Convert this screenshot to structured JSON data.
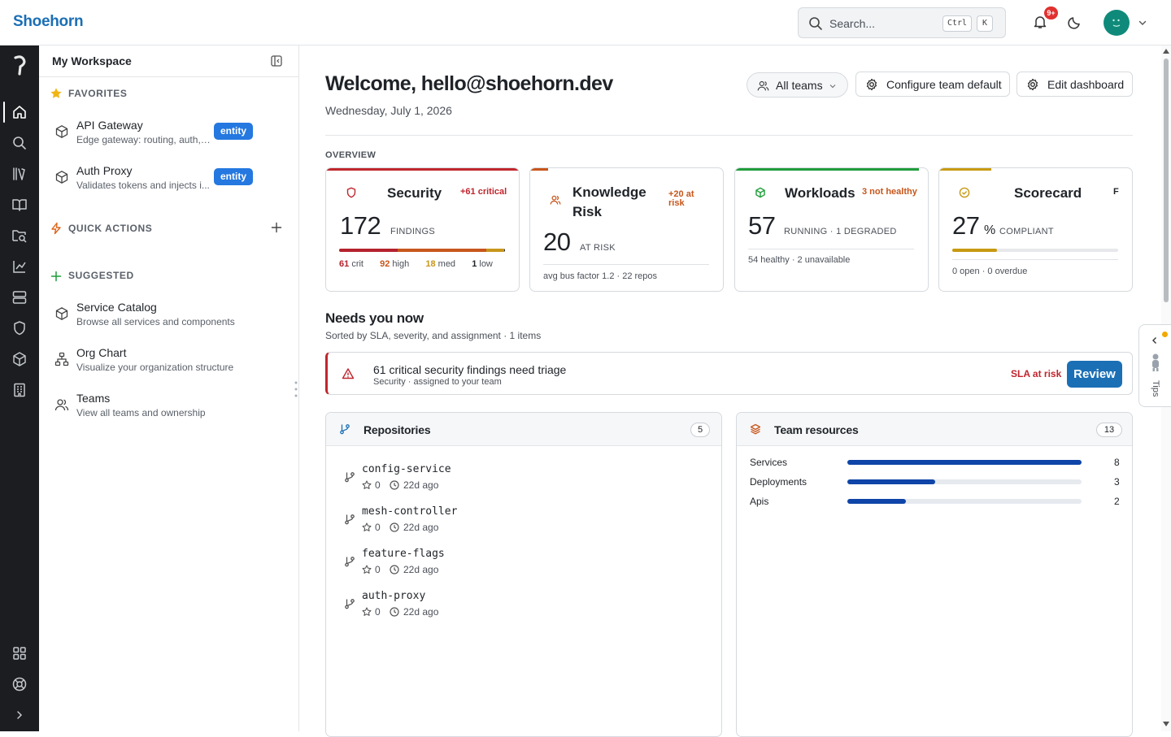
{
  "app": {
    "name": "Shoehorn"
  },
  "header": {
    "search_placeholder": "Search...",
    "shortcut_key1": "Ctrl",
    "shortcut_key2": "K",
    "notification_count": "9+"
  },
  "sidebar": {
    "title": "My Workspace",
    "favorites_label": "FAVORITES",
    "favorites": [
      {
        "title": "API Gateway",
        "subtitle": "Edge gateway: routing, auth, ...",
        "badge": "entity"
      },
      {
        "title": "Auth Proxy",
        "subtitle": "Validates tokens and injects i...",
        "badge": "entity"
      }
    ],
    "quick_actions_label": "QUICK ACTIONS",
    "suggested_label": "SUGGESTED",
    "suggested": [
      {
        "title": "Service Catalog",
        "subtitle": "Browse all services and components"
      },
      {
        "title": "Org Chart",
        "subtitle": "Visualize your organization structure"
      },
      {
        "title": "Teams",
        "subtitle": "View all teams and ownership"
      }
    ]
  },
  "main": {
    "welcome": "Welcome, hello@shoehorn.dev",
    "date": "Wednesday, July 1, 2026",
    "buttons": {
      "teams": "All teams",
      "configure": "Configure team default",
      "edit": "Edit dashboard"
    },
    "overview_label": "OVERVIEW",
    "cards": {
      "security": {
        "title": "Security",
        "delta": "+61 critical",
        "value": "172",
        "unit": "FINDINGS",
        "breakdown": [
          {
            "n": "61",
            "l": "crit",
            "color": "#b4222d"
          },
          {
            "n": "92",
            "l": "high",
            "color": "#c8561b"
          },
          {
            "n": "18",
            "l": "med",
            "color": "#c8961b"
          },
          {
            "n": "1",
            "l": "low",
            "color": "#1f2328"
          }
        ],
        "accent": "#c0262d"
      },
      "knowledge": {
        "title": "Knowledge Risk",
        "delta": "+20 at risk",
        "value": "20",
        "unit": "AT RISK",
        "foot": "avg bus factor 1.2 · 22 repos",
        "accent": "#c8561b"
      },
      "workloads": {
        "title": "Workloads",
        "delta": "3 not healthy",
        "value": "57",
        "unit": "RUNNING · 1 DEGRADED",
        "foot": "54 healthy · 2 unavailable",
        "accent": "#1f9d3a"
      },
      "scorecard": {
        "title": "Scorecard",
        "grade": "F",
        "value": "27",
        "percent": "%",
        "unit": "COMPLIANT",
        "foot": "0 open · 0 overdue",
        "progress": 0.27,
        "accent": "#c89a12"
      }
    },
    "needs": {
      "title": "Needs you now",
      "subtitle": "Sorted by SLA, severity, and assignment · 1 items",
      "alert": {
        "title": "61 critical security findings need triage",
        "subtitle": "Security · assigned to your team",
        "sla": "SLA at risk",
        "action": "Review"
      }
    },
    "repositories": {
      "title": "Repositories",
      "count": "5",
      "items": [
        {
          "name": "config-service",
          "stars": "0",
          "updated": "22d ago"
        },
        {
          "name": "mesh-controller",
          "stars": "0",
          "updated": "22d ago"
        },
        {
          "name": "feature-flags",
          "stars": "0",
          "updated": "22d ago"
        },
        {
          "name": "auth-proxy",
          "stars": "0",
          "updated": "22d ago"
        }
      ]
    },
    "resources": {
      "title": "Team resources",
      "count": "13",
      "items": [
        {
          "label": "Services",
          "value": "8",
          "fraction": 1.0
        },
        {
          "label": "Deployments",
          "value": "3",
          "fraction": 0.375
        },
        {
          "label": "Apis",
          "value": "2",
          "fraction": 0.25
        }
      ]
    }
  },
  "tips": {
    "label": "Tips"
  }
}
